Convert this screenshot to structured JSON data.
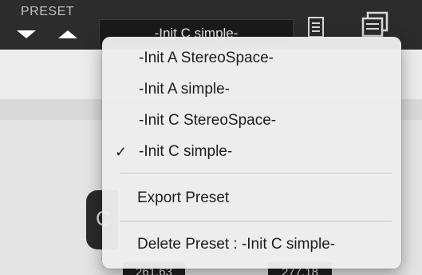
{
  "toolbar": {
    "preset_label": "PRESET",
    "current_preset": "-Init C simple-"
  },
  "background": {
    "knob_char": "C",
    "readout_1": "261.63",
    "readout_2": "277.18"
  },
  "menu": {
    "presets": [
      {
        "label": "-Init A StereoSpace-",
        "checked": false
      },
      {
        "label": "-Init A simple-",
        "checked": false
      },
      {
        "label": "-Init C StereoSpace-",
        "checked": false
      },
      {
        "label": "-Init C simple-",
        "checked": true
      }
    ],
    "check_glyph": "✓",
    "export_label": "Export Preset",
    "delete_label": "Delete Preset : -Init C simple-"
  }
}
